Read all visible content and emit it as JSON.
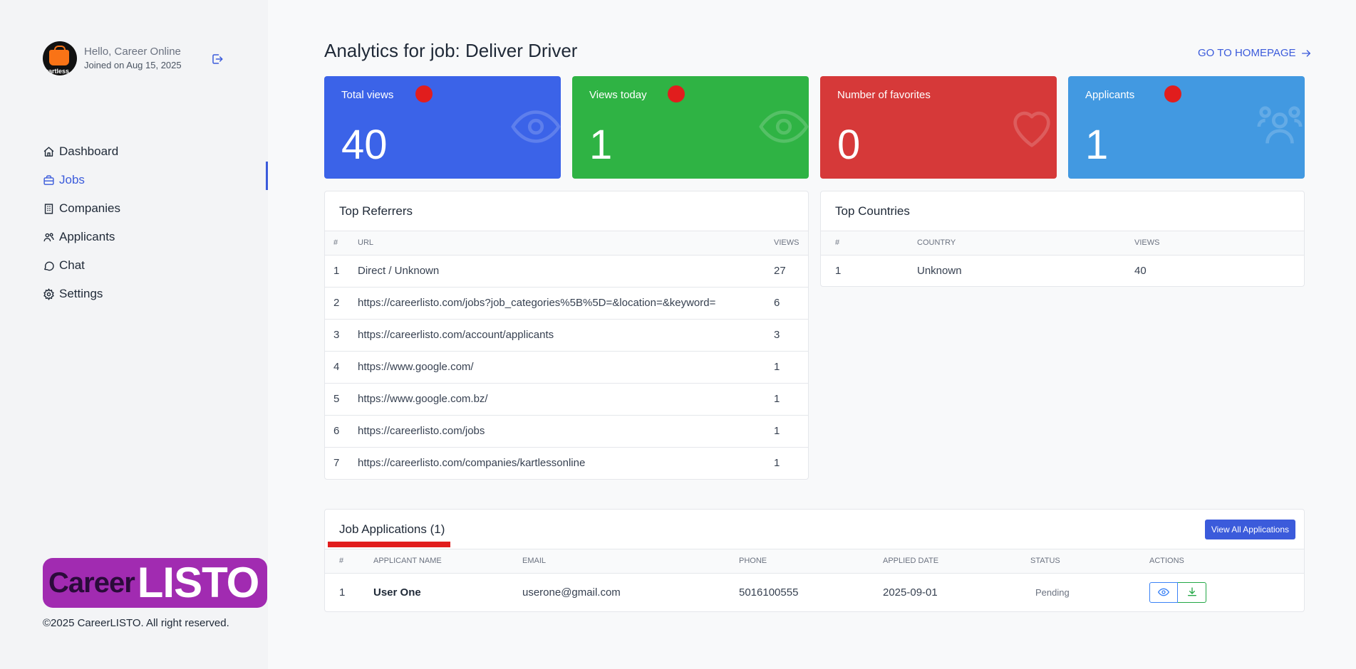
{
  "profile": {
    "avatar_text": "kartless",
    "greeting": "Hello, Career Online",
    "joined": "Joined on Aug 15, 2025"
  },
  "nav": {
    "items": [
      {
        "label": "Dashboard",
        "icon": "home-icon"
      },
      {
        "label": "Jobs",
        "icon": "briefcase-icon",
        "active": true
      },
      {
        "label": "Companies",
        "icon": "building-icon"
      },
      {
        "label": "Applicants",
        "icon": "users-icon"
      },
      {
        "label": "Chat",
        "icon": "chat-icon"
      },
      {
        "label": "Settings",
        "icon": "gear-icon"
      }
    ]
  },
  "brand": {
    "part1": "Career",
    "part2": "LISTO"
  },
  "footer": {
    "copyright": "©2025 CareerLISTO. All right reserved."
  },
  "header": {
    "title": "Analytics for job: Deliver Driver",
    "home_link": "GO TO HOMEPAGE"
  },
  "stats": [
    {
      "label": "Total views",
      "value": "40",
      "color": "#3b63e8",
      "icon": "eye-icon"
    },
    {
      "label": "Views today",
      "value": "1",
      "color": "#2fb344",
      "icon": "eye-icon"
    },
    {
      "label": "Number of favorites",
      "value": "0",
      "color": "#d63939",
      "icon": "heart-icon"
    },
    {
      "label": "Applicants",
      "value": "1",
      "color": "#4299e1",
      "icon": "users-icon"
    }
  ],
  "referrers": {
    "title": "Top Referrers",
    "columns": [
      "#",
      "URL",
      "VIEWS"
    ],
    "rows": [
      [
        "1",
        "Direct / Unknown",
        "27"
      ],
      [
        "2",
        "https://careerlisto.com/jobs?job_categories%5B%5D=&location=&keyword=",
        "6"
      ],
      [
        "3",
        "https://careerlisto.com/account/applicants",
        "3"
      ],
      [
        "4",
        "https://www.google.com/",
        "1"
      ],
      [
        "5",
        "https://www.google.com.bz/",
        "1"
      ],
      [
        "6",
        "https://careerlisto.com/jobs",
        "1"
      ],
      [
        "7",
        "https://careerlisto.com/companies/kartlessonline",
        "1"
      ]
    ]
  },
  "countries": {
    "title": "Top Countries",
    "columns": [
      "#",
      "COUNTRY",
      "VIEWS"
    ],
    "rows": [
      [
        "1",
        "Unknown",
        "40"
      ]
    ]
  },
  "applications": {
    "title": "Job Applications (1)",
    "view_all": "View All Applications",
    "columns": [
      "#",
      "APPLICANT NAME",
      "EMAIL",
      "PHONE",
      "APPLIED DATE",
      "STATUS",
      "ACTIONS"
    ],
    "rows": [
      {
        "num": "1",
        "name": "User One",
        "email": "userone@gmail.com",
        "phone": "5016100555",
        "date": "2025-09-01",
        "status": "Pending"
      }
    ]
  }
}
